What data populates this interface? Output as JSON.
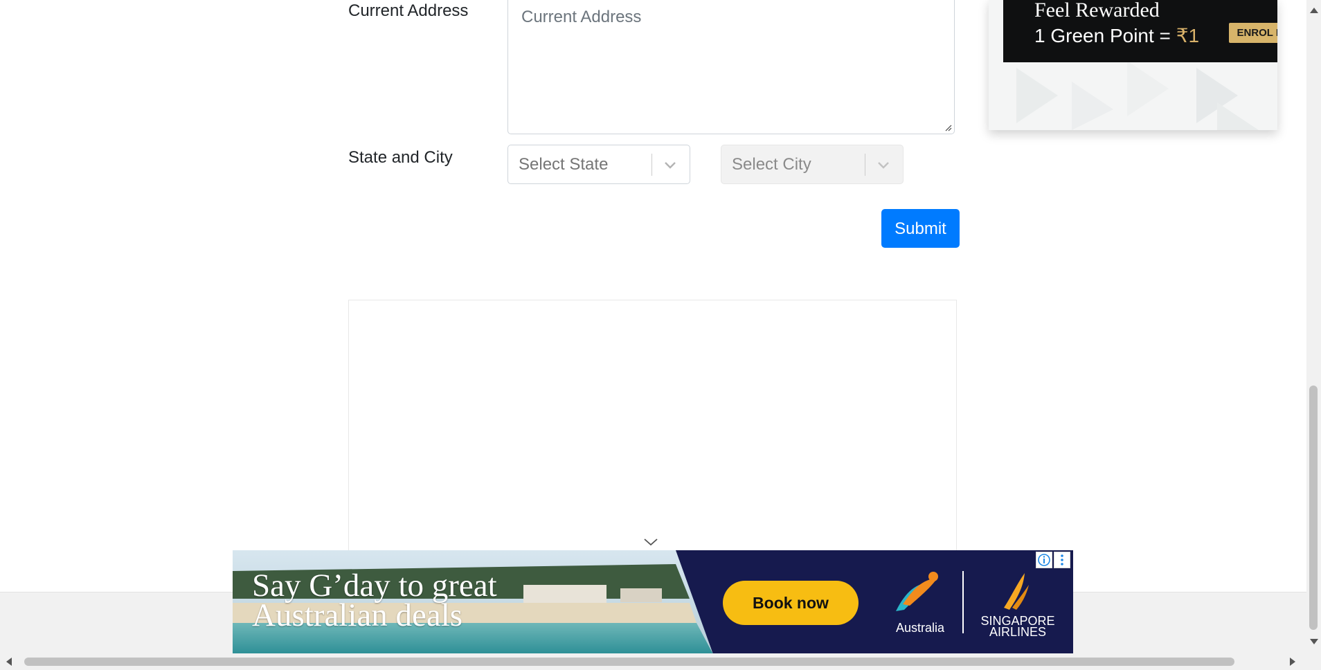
{
  "form": {
    "current_address_label": "Current Address",
    "current_address_placeholder": "Current Address",
    "state_city_label": "State and City",
    "state_placeholder": "Select State",
    "city_placeholder": "Select City",
    "submit_label": "Submit"
  },
  "ad_top": {
    "line1": "Feel Rewarded",
    "line2_prefix": "1 Green Point = ",
    "line2_value": "₹1",
    "cta": "ENROL NOW"
  },
  "ad_bottom": {
    "headline_line1": "Say G’day to great",
    "headline_line2": "Australian deals",
    "cta": "Book now",
    "brand1": "Australia",
    "brand2_line1": "SINGAPORE",
    "brand2_line2": "AIRLINES"
  },
  "colors": {
    "primary_button": "#007bff",
    "ad_gold": "#f7bd12",
    "ad_navy": "#161a4e"
  }
}
